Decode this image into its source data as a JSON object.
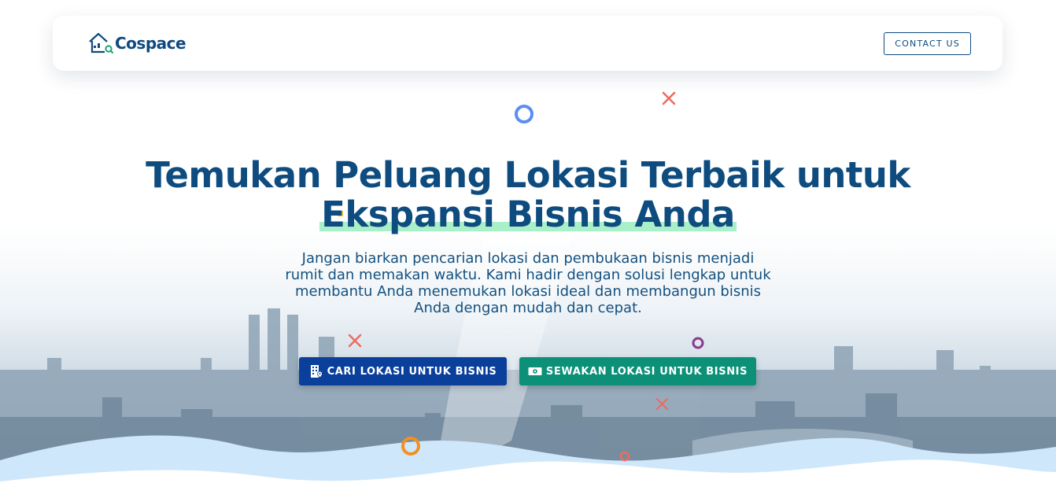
{
  "brand": {
    "name": "Cospace",
    "logo_icon": "house-search-icon"
  },
  "nav": {
    "contact_label": "CONTACT US"
  },
  "hero": {
    "headline_line1": "Temukan Peluang Lokasi Terbaik untuk",
    "headline_highlight": "Ekspansi Bisnis Anda",
    "subtitle": "Jangan biarkan pencarian lokasi dan pembukaan bisnis menjadi rumit dan memakan waktu. Kami hadir dengan solusi lengkap untuk membantu Anda menemukan lokasi ideal dan membangun bisnis Anda dengan mudah dan cepat.",
    "background": "city-skyline-image"
  },
  "actions": {
    "find": {
      "label": "CARI LOKASI UNTUK BISNIS",
      "icon": "building-location-icon",
      "color": "#0a3f9c"
    },
    "rent": {
      "label": "SEWAKAN LOKASI UNTUK BISNIS",
      "icon": "money-bill-icon",
      "color": "#0c9078"
    }
  },
  "colors": {
    "primary": "#0e4c80",
    "highlight": "#a9f0c8",
    "decor_blue": "#5b8df5",
    "decor_red": "#f06a5e",
    "decor_purple": "#8a3b8c",
    "decor_orange": "#f39020"
  }
}
